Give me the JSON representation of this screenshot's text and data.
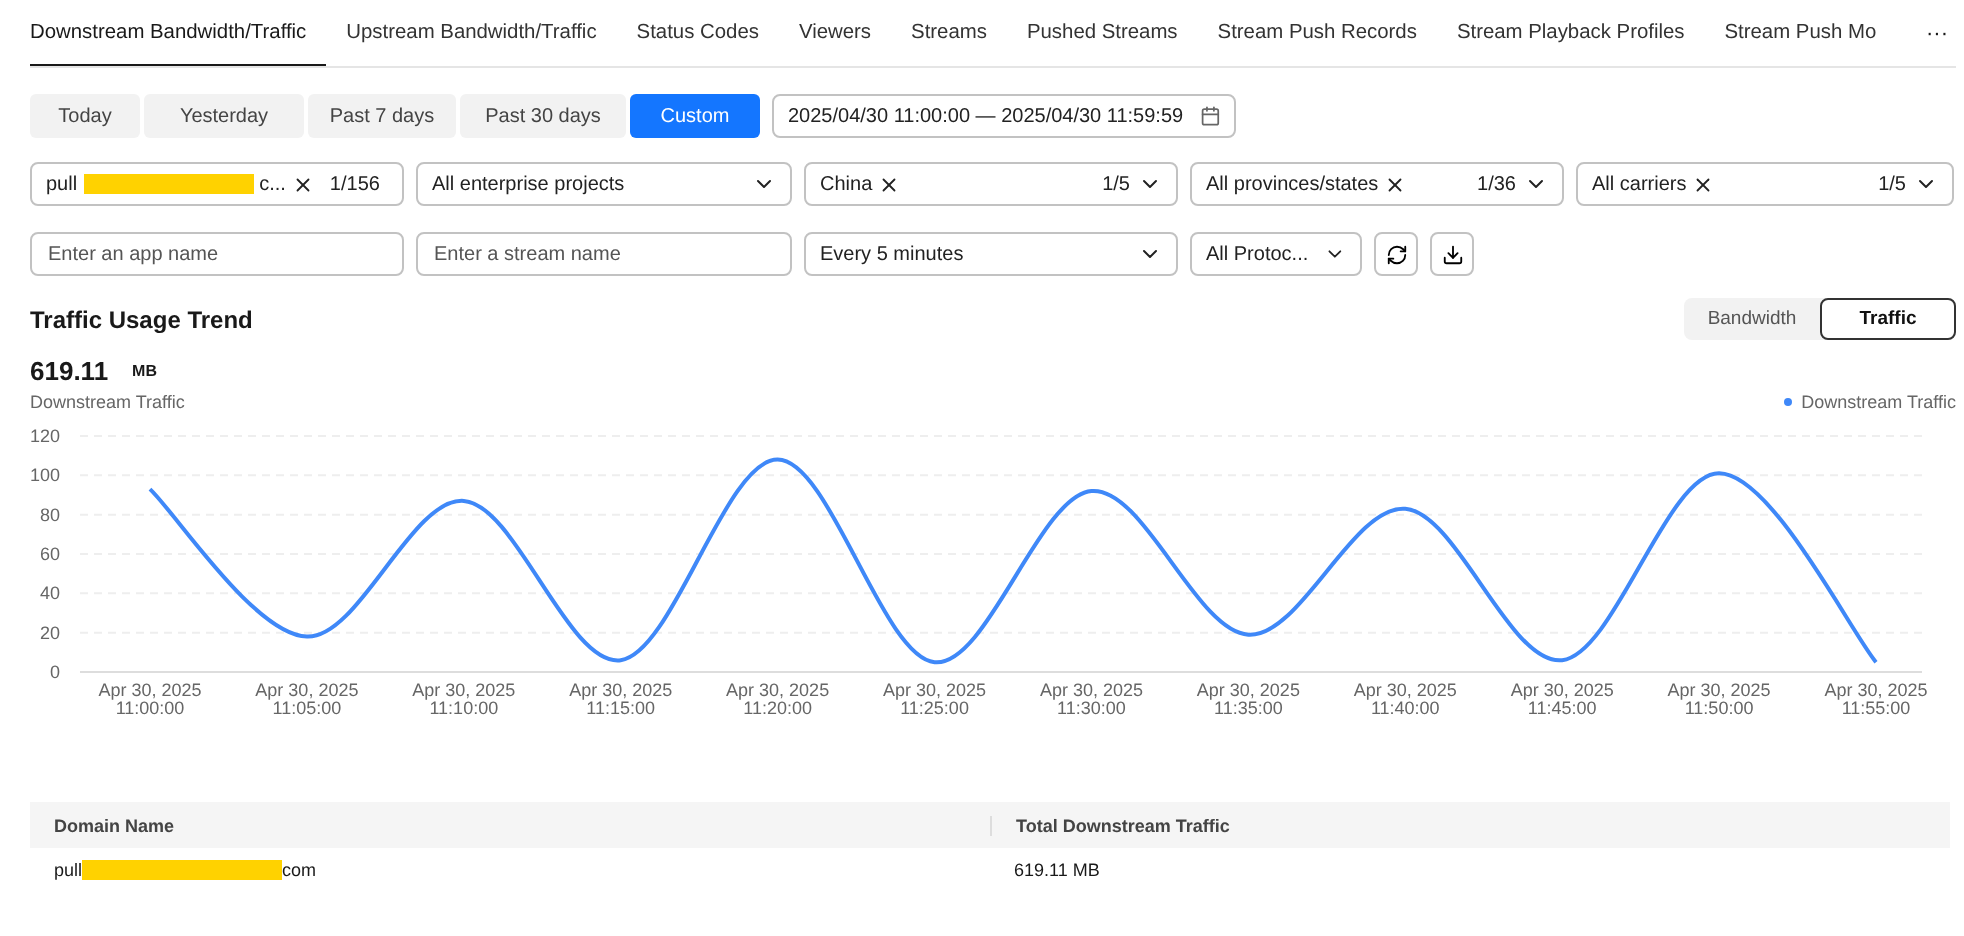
{
  "tabs": [
    {
      "label": "Downstream Bandwidth/Traffic",
      "selected": true
    },
    {
      "label": "Upstream Bandwidth/Traffic",
      "selected": false
    },
    {
      "label": "Status Codes",
      "selected": false
    },
    {
      "label": "Viewers",
      "selected": false
    },
    {
      "label": "Streams",
      "selected": false
    },
    {
      "label": "Pushed Streams",
      "selected": false
    },
    {
      "label": "Stream Push Records",
      "selected": false
    },
    {
      "label": "Stream Playback Profiles",
      "selected": false
    },
    {
      "label": "Stream Push Mo",
      "selected": false
    }
  ],
  "more_icon": "···",
  "time_ranges": [
    {
      "label": "Today",
      "selected": false
    },
    {
      "label": "Yesterday",
      "selected": false
    },
    {
      "label": "Past 7 days",
      "selected": false
    },
    {
      "label": "Past 30 days",
      "selected": false
    },
    {
      "label": "Custom",
      "selected": true
    }
  ],
  "date_range": "2025/04/30 11:00:00 — 2025/04/30 11:59:59",
  "filters": [
    {
      "kind": "tags",
      "tag_prefix": "pull",
      "tag_suffix": "c...",
      "count": "1/156"
    },
    {
      "kind": "select",
      "value": "All enterprise projects"
    },
    {
      "kind": "tags",
      "tag_prefix": "China",
      "count": "1/5"
    },
    {
      "kind": "tags",
      "tag_prefix": "All provinces/states",
      "count": "1/36"
    },
    {
      "kind": "tags",
      "tag_prefix": "All carriers",
      "count": "1/5"
    }
  ],
  "app_field": {
    "placeholder": "Enter an app name"
  },
  "stream_field": {
    "placeholder": "Enter a stream name"
  },
  "interval": "Every 5 minutes",
  "protocol": "All Protoc...",
  "section_title": "Traffic Usage Trend",
  "view_toggle": [
    {
      "label": "Bandwidth",
      "selected": false
    },
    {
      "label": "Traffic",
      "selected": true
    }
  ],
  "total": {
    "value": "619.11",
    "unit": "MB",
    "label": "Downstream Traffic"
  },
  "chart": {
    "chart_data": {
      "type": "line",
      "categories": [
        "Apr 30, 2025\n11:00:00",
        "Apr 30, 2025\n11:05:00",
        "Apr 30, 2025\n11:10:00",
        "Apr 30, 2025\n11:15:00",
        "Apr 30, 2025\n11:20:00",
        "Apr 30, 2025\n11:25:00",
        "Apr 30, 2025\n11:30:00",
        "Apr 30, 2025\n11:35:00",
        "Apr 30, 2025\n11:40:00",
        "Apr 30, 2025\n11:45:00",
        "Apr 30, 2025\n11:50:00",
        "Apr 30, 2025\n11:55:00"
      ],
      "series": [
        {
          "name": "Downstream Traffic",
          "color": "#3f88f8",
          "values": [
            93,
            18,
            87,
            6,
            108,
            5,
            92,
            19,
            83,
            6,
            101,
            5
          ]
        }
      ],
      "grid": true,
      "ylim": [
        0,
        120
      ],
      "yticks": [
        0,
        20,
        40,
        60,
        80,
        100,
        120
      ]
    }
  },
  "table": {
    "columns": [
      "Domain Name",
      "Total Downstream Traffic"
    ],
    "rows": [
      {
        "domain_prefix": "pull",
        "domain_suffix": "com",
        "traffic": "619.11 MB"
      }
    ]
  }
}
